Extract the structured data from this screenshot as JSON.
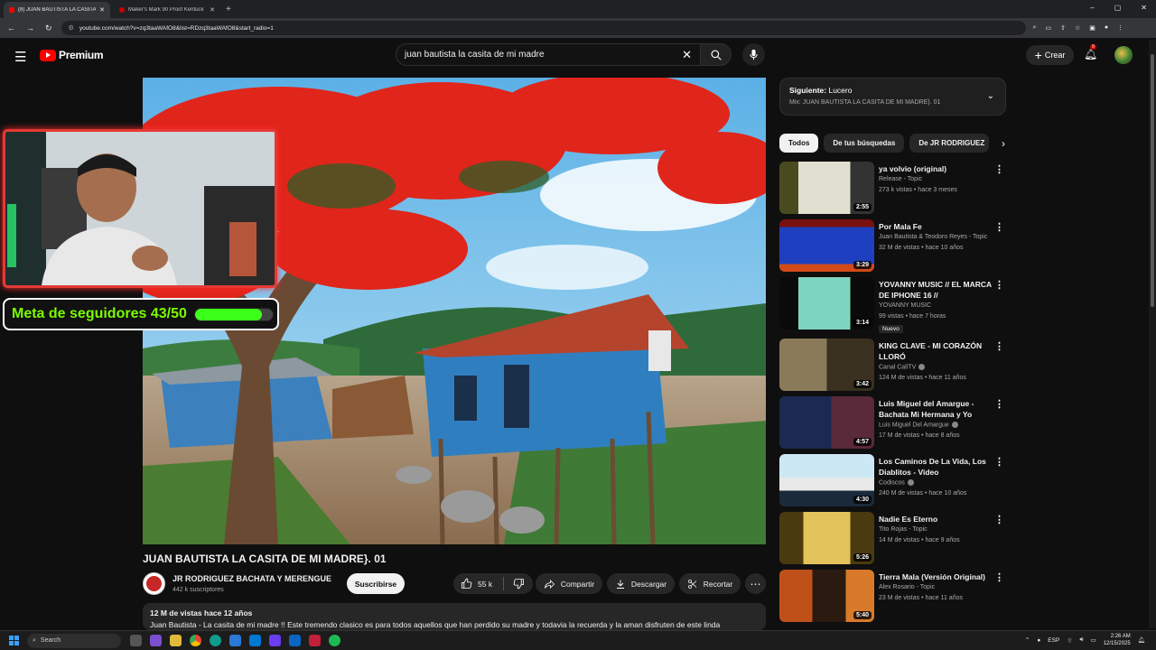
{
  "browser": {
    "tabs": [
      {
        "title": "(8) JUAN BAUTISTA LA CASITA I",
        "active": true
      },
      {
        "title": "Maker's Mark 90 Proof Kentuck",
        "active": false
      }
    ],
    "url": "youtube.com/watch?v=zq3taaWAfO8&list=RDzq3taaWAfO8&start_radio=1"
  },
  "header": {
    "logo_text": "Premium",
    "search_query": "juan bautista la casita de mi madre",
    "create_label": "Crear",
    "notif_count": "9"
  },
  "overlay": {
    "goal_text": "Meta de seguidores 43/50",
    "goal_progress": 0.86
  },
  "video": {
    "title": "JUAN BAUTISTA LA CASITA DE MI MADRE}. 01",
    "channel": "JR RODRIGUEZ BACHATA Y MERENGUE",
    "subscribers": "442 k suscriptores",
    "subscribe_label": "Suscribirse",
    "likes": "55 k",
    "share_label": "Compartir",
    "download_label": "Descargar",
    "clip_label": "Recortar",
    "views_date": "12 M de vistas  hace 12 años",
    "description": "Juan Bautista - La casita de  mi madre !! Este tremendo clasico es para todos aquellos que han perdido su madre y todavia la recuerda y la aman disfruten de este linda"
  },
  "sidebar": {
    "upnext_label": "Siguiente:",
    "upnext_title": "Lucero",
    "upnext_mix": "Mix: JUAN BAUTISTA LA CASITA DE MI MADRE}. 01",
    "chips": [
      "Todos",
      "De tus búsquedas",
      "De JR RODRIGUEZ"
    ],
    "items": [
      {
        "title": "ya volvio (original)",
        "channel": "Release - Topic",
        "meta": "273 k vistas • hace 3 meses",
        "duration": "2:55"
      },
      {
        "title": "Por Mala Fe",
        "channel": "Juan Bautista & Teodoro Reyes - Topic",
        "meta": "32 M de vistas • hace 10 años",
        "duration": "3:29"
      },
      {
        "title": "YOVANNY MUSIC // EL MARCA DE IPHONE 16 //",
        "channel": "YOVANNY MUSIC",
        "meta": "99 vistas • hace 7 horas",
        "duration": "3:14",
        "badge": "Nuevo"
      },
      {
        "title": "KING CLAVE - MI CORAZÓN LLORÓ",
        "channel": "Canal CaliTV",
        "meta": "124 M de vistas • hace 11 años",
        "duration": "3:42"
      },
      {
        "title": "Luis Miguel del Amargue - Bachata Mi Hermana y Yo",
        "channel": "Luis Miguel Del Amargue",
        "meta": "17 M de vistas • hace 8 años",
        "duration": "4:57"
      },
      {
        "title": "Los Caminos De La Vida, Los Diablitos - Video",
        "channel": "Codiscos",
        "meta": "240 M de vistas • hace 10 años",
        "duration": "4:30"
      },
      {
        "title": "Nadie Es Eterno",
        "channel": "Tito Rojas - Topic",
        "meta": "14 M de vistas • hace 9 años",
        "duration": "5:26"
      },
      {
        "title": "Tierra Mala (Versión Original)",
        "channel": "Alex Rosario - Topic",
        "meta": "23 M de vistas • hace 11 años",
        "duration": "5:40"
      }
    ]
  },
  "taskbar": {
    "search_label": "Search",
    "lang": "ESP",
    "time": "2:26 AM",
    "date": "12/15/2025"
  }
}
